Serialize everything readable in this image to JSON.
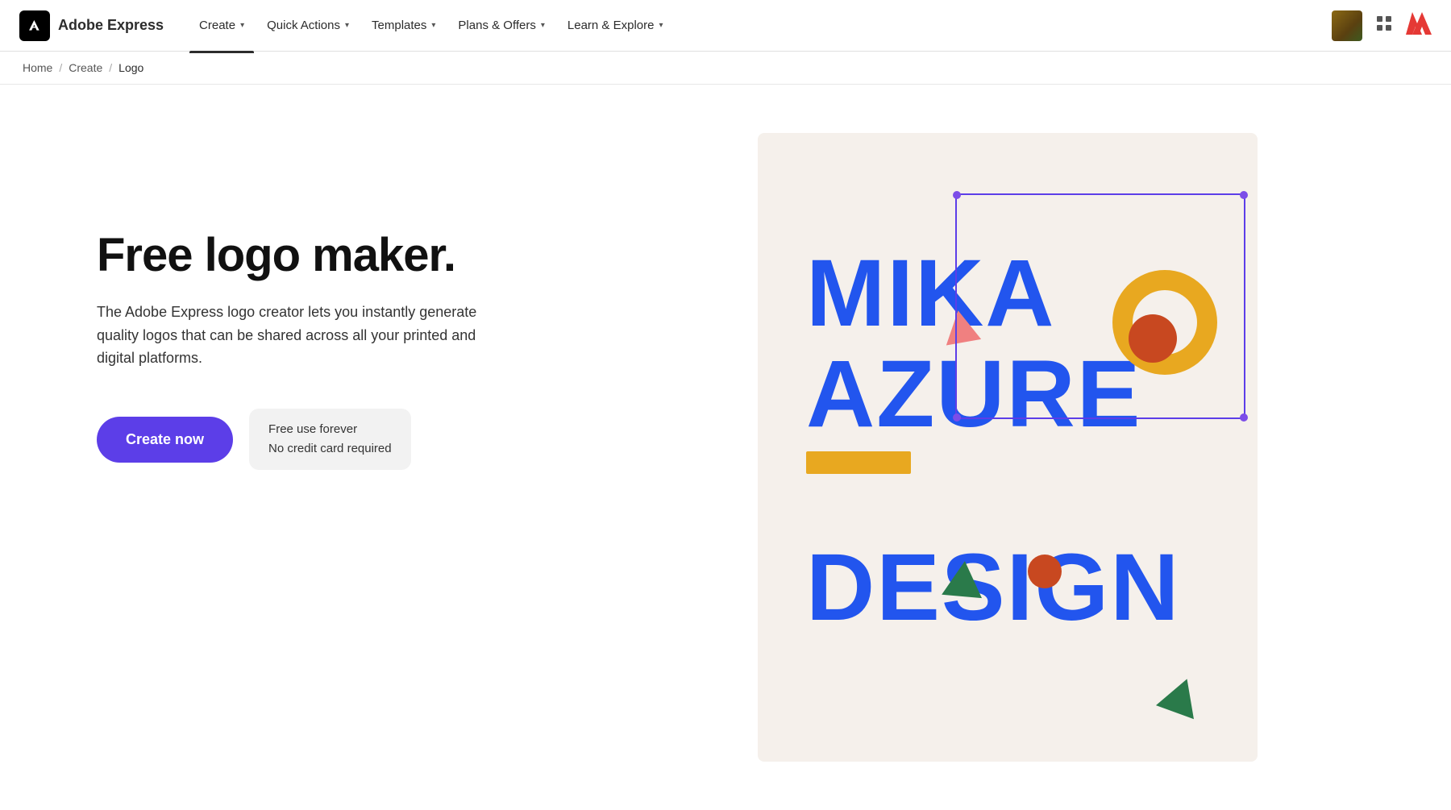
{
  "nav": {
    "logo_text": "Adobe Express",
    "items": [
      {
        "id": "create",
        "label": "Create",
        "active": true
      },
      {
        "id": "quick-actions",
        "label": "Quick Actions",
        "active": false
      },
      {
        "id": "templates",
        "label": "Templates",
        "active": false
      },
      {
        "id": "plans-offers",
        "label": "Plans & Offers",
        "active": false
      },
      {
        "id": "learn-explore",
        "label": "Learn & Explore",
        "active": false
      }
    ]
  },
  "breadcrumb": {
    "home": "Home",
    "create": "Create",
    "current": "Logo"
  },
  "hero": {
    "title": "Free logo maker.",
    "description": "The Adobe Express logo creator lets you instantly generate quality logos that can be shared across all your printed and digital platforms.",
    "cta_label": "Create now",
    "free_line1": "Free use forever",
    "free_line2": "No credit card required"
  },
  "logo_preview": {
    "text1": "MIKA",
    "text2": "AZURE",
    "text3": "DESIGN"
  },
  "colors": {
    "nav_underline": "#2c2c2c",
    "cta_bg": "#5c3ee8",
    "logo_blue": "#2255ee",
    "selection_purple": "#7c4de8",
    "orange_arc": "#e8a820",
    "orange_circle": "#c84820",
    "green_shape": "#2a7a4a",
    "pink_shape": "#f08080",
    "card_bg": "#f5f0eb"
  }
}
